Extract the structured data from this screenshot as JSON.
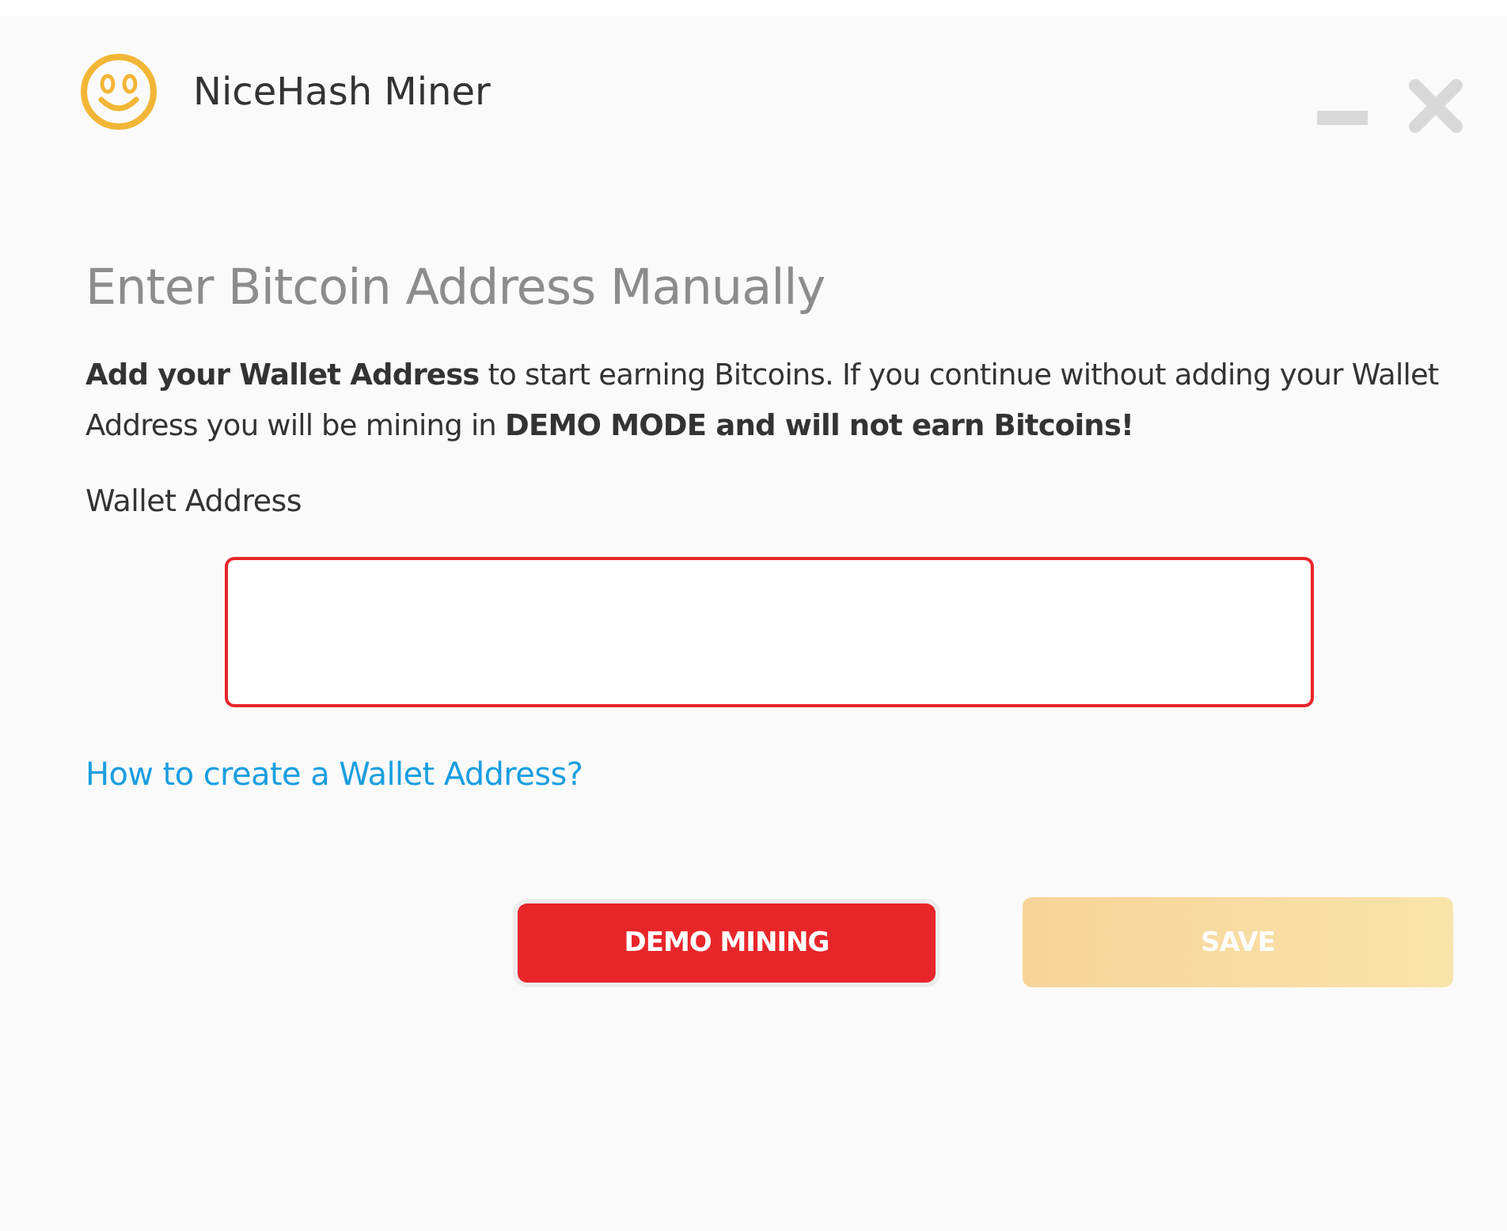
{
  "window": {
    "title": "NiceHash Miner"
  },
  "heading": "Enter Bitcoin Address Manually",
  "intro": "**Add your Wallet Address**  to start earning Bitcoins. If you continue without adding your Wallet Address you will be mining in  **DEMO MODE and will not earn Bitcoins!**",
  "wallet_field": {
    "label": "Wallet Address",
    "invalid": true
  },
  "help_link": "How to create a Wallet Address?",
  "buttons": [
    {
      "kind": "secondary",
      "label": "DEMO MINING",
      "disabled": false
    },
    {
      "kind": "primary",
      "label": "SAVE",
      "disabled": true
    }
  ]
}
